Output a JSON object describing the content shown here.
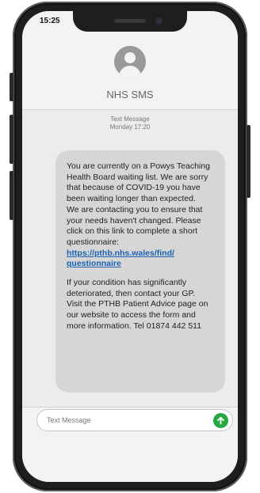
{
  "status_bar": {
    "time": "15:25"
  },
  "header": {
    "contact_name": "NHS SMS",
    "avatar_icon": "person-icon"
  },
  "thread": {
    "meta_type": "Text Message",
    "meta_date": "Monday 17:20"
  },
  "message": {
    "para1_lines": [
      "You are currently on a Powys Teaching",
      "Health Board waiting list. We are sorry",
      "that because of COVID-19 you have",
      "been waiting longer than expected.",
      "We are contacting you to ensure that",
      "your needs haven't changed. Please",
      "click on this link to complete a short",
      "questionnaire:"
    ],
    "link_lines": [
      "https://pthb.nhs.wales/find/",
      "questionnaire"
    ],
    "para2_lines": [
      "If your condition has significantly",
      "deteriorated, then contact your GP.",
      "Visit the PTHB Patient Advice page on",
      "our website to access the form and",
      "more information. Tel 01874 442 511"
    ]
  },
  "compose": {
    "placeholder": "Text Message",
    "send_icon": "arrow-up-icon",
    "send_color": "#27a843"
  }
}
